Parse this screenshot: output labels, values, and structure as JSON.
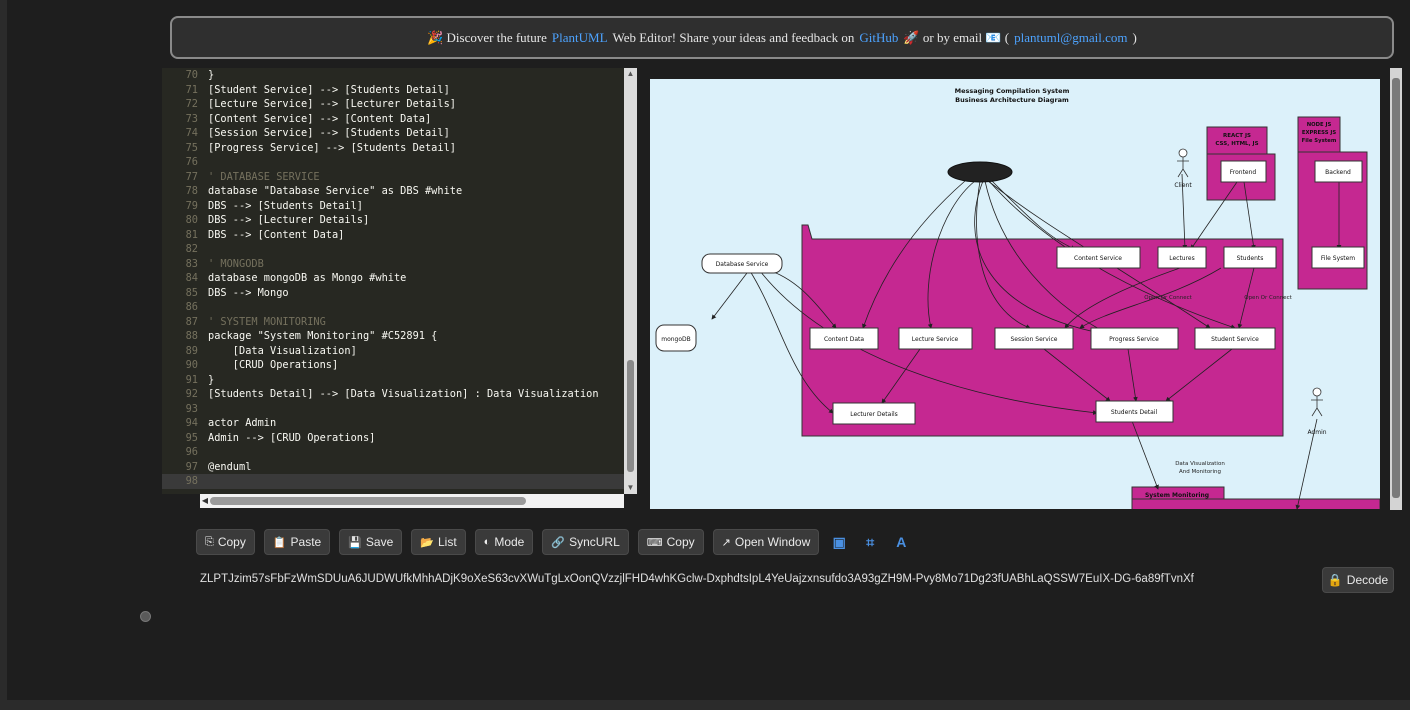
{
  "banner": {
    "prefix": "🎉 Discover the future",
    "plantuml_link": "PlantUML",
    "middle": "Web Editor! Share your ideas and feedback on",
    "github_link": "GitHub",
    "suffix": "🚀 or by email 📧 (",
    "email_link": "plantuml@gmail.com",
    "end": ")"
  },
  "editor": {
    "lines": [
      {
        "n": "70",
        "t": "}"
      },
      {
        "n": "71",
        "t": "[Student Service] --> [Students Detail]"
      },
      {
        "n": "72",
        "t": "[Lecture Service] --> [Lecturer Details]"
      },
      {
        "n": "73",
        "t": "[Content Service] --> [Content Data]"
      },
      {
        "n": "74",
        "t": "[Session Service] --> [Students Detail]"
      },
      {
        "n": "75",
        "t": "[Progress Service] --> [Students Detail]"
      },
      {
        "n": "76",
        "t": ""
      },
      {
        "n": "77",
        "t": "' DATABASE SERVICE"
      },
      {
        "n": "78",
        "t": "database \"Database Service\" as DBS #white"
      },
      {
        "n": "79",
        "t": "DBS --> [Students Detail]"
      },
      {
        "n": "80",
        "t": "DBS --> [Lecturer Details]"
      },
      {
        "n": "81",
        "t": "DBS --> [Content Data]"
      },
      {
        "n": "82",
        "t": ""
      },
      {
        "n": "83",
        "t": "' MONGODB"
      },
      {
        "n": "84",
        "t": "database mongoDB as Mongo #white"
      },
      {
        "n": "85",
        "t": "DBS --> Mongo"
      },
      {
        "n": "86",
        "t": ""
      },
      {
        "n": "87",
        "t": "' SYSTEM MONITORING"
      },
      {
        "n": "88",
        "t": "package \"System Monitoring\" #C52891 {"
      },
      {
        "n": "89",
        "t": "    [Data Visualization]"
      },
      {
        "n": "90",
        "t": "    [CRUD Operations]"
      },
      {
        "n": "91",
        "t": "}"
      },
      {
        "n": "92",
        "t": "[Students Detail] --> [Data Visualization] : Data Visualization"
      },
      {
        "n": "93",
        "t": ""
      },
      {
        "n": "94",
        "t": "actor Admin"
      },
      {
        "n": "95",
        "t": "Admin --> [CRUD Operations]"
      },
      {
        "n": "96",
        "t": ""
      },
      {
        "n": "97",
        "t": "@enduml"
      },
      {
        "n": "98",
        "t": ""
      }
    ]
  },
  "diagram": {
    "title_line1": "Messaging Compilation System",
    "title_line2": "Business Architecture Diagram",
    "react_pkg": [
      "REACT JS",
      "CSS, HTML, JS"
    ],
    "node_pkg": [
      "NODE JS",
      "EXPRESS JS",
      "File System"
    ],
    "cloud_label": "",
    "actor_client": "Client",
    "actor_admin": "Admin",
    "frontend": "Frontend",
    "backend": "Backend",
    "file_system": "File System",
    "database_service": "Database Service",
    "mongodb": "mongoDB",
    "content_service": "Content Service",
    "lectures": "Lectures",
    "students": "Students",
    "socket_label_1": "Open Or Connect",
    "socket_label_2": "Open Or Connect",
    "content_data": "Content Data",
    "lecture_service": "Lecture Service",
    "session_service": "Session Service",
    "progress_service": "Progress Service",
    "student_service": "Student Service",
    "lecturer_details": "Lecturer Details",
    "students_detail": "Students Detail",
    "dv_label_1": "Data Visualization",
    "dv_label_2": "And Monitoring",
    "system_monitoring": "System Monitoring",
    "colors": {
      "package": "#c52891",
      "background": "#dcf1fa"
    }
  },
  "toolbar": {
    "copy": "Copy",
    "paste": "Paste",
    "save": "Save",
    "list": "List",
    "mode": "Mode",
    "syncurl": "SyncURL",
    "copy2": "Copy",
    "open_window": "Open Window"
  },
  "url": {
    "value": "ZLPTJzim57sFbFzWmSDUuA6JUDWUfkMhhADjK9oXeS63cvXWuTgLxOonQVzzjlFHD4whKGclw-DxphdtsIpL4YeUajzxnsufdo3A93gZH9M-Pvy8Mo71Dg23fUABhLaQSSW7EuIX-DG-6a89fTvnXf"
  },
  "decode_label": "Decode"
}
